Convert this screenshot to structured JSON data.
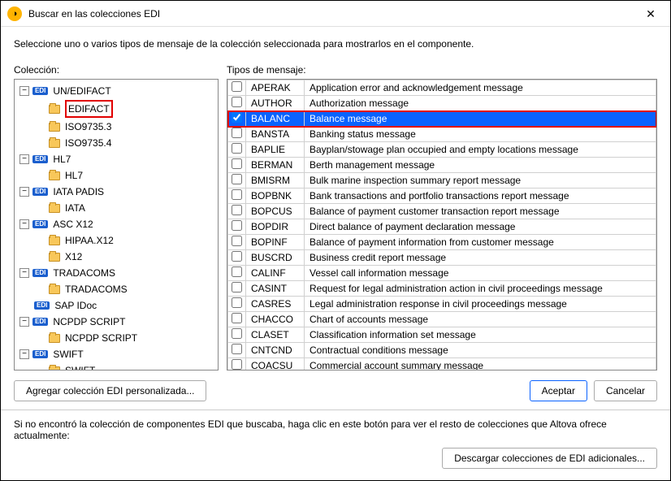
{
  "window": {
    "title": "Buscar en las colecciones EDI"
  },
  "instruction": "Seleccione uno o varios tipos de mensaje de la colección seleccionada para mostrarlos en el componente.",
  "labels": {
    "collection": "Colección:",
    "message_types": "Tipos de mensaje:",
    "add_custom": "Agregar colección EDI personalizada...",
    "accept": "Aceptar",
    "cancel": "Cancelar",
    "footer_text": "Si no encontró la colección de componentes EDI que buscaba, haga clic en este botón para ver el resto de colecciones que Altova ofrece actualmente:",
    "download_more": "Descargar colecciones de EDI adicionales..."
  },
  "tree": [
    {
      "label": "UN/EDIFACT",
      "icon": "edi",
      "expanded": true,
      "children": [
        {
          "label": "EDIFACT",
          "icon": "folder",
          "highlight": true
        },
        {
          "label": "ISO9735.3",
          "icon": "folder"
        },
        {
          "label": "ISO9735.4",
          "icon": "folder"
        }
      ]
    },
    {
      "label": "HL7",
      "icon": "edi",
      "expanded": true,
      "children": [
        {
          "label": "HL7",
          "icon": "folder"
        }
      ]
    },
    {
      "label": "IATA PADIS",
      "icon": "edi",
      "expanded": true,
      "children": [
        {
          "label": "IATA",
          "icon": "folder"
        }
      ]
    },
    {
      "label": "ASC X12",
      "icon": "edi",
      "expanded": true,
      "children": [
        {
          "label": "HIPAA.X12",
          "icon": "folder"
        },
        {
          "label": "X12",
          "icon": "folder"
        }
      ]
    },
    {
      "label": "TRADACOMS",
      "icon": "edi",
      "expanded": true,
      "children": [
        {
          "label": "TRADACOMS",
          "icon": "folder"
        }
      ]
    },
    {
      "label": "SAP IDoc",
      "icon": "edi",
      "leaf": true
    },
    {
      "label": "NCPDP SCRIPT",
      "icon": "edi",
      "expanded": true,
      "children": [
        {
          "label": "NCPDP SCRIPT",
          "icon": "folder"
        }
      ]
    },
    {
      "label": "SWIFT",
      "icon": "edi",
      "expanded": true,
      "children": [
        {
          "label": "SWIFT",
          "icon": "folder"
        }
      ]
    }
  ],
  "messages": [
    {
      "code": "APERAK",
      "desc": "Application error and acknowledgement message",
      "checked": false
    },
    {
      "code": "AUTHOR",
      "desc": "Authorization message",
      "checked": false
    },
    {
      "code": "BALANC",
      "desc": "Balance message",
      "checked": true,
      "selected": true
    },
    {
      "code": "BANSTA",
      "desc": "Banking status message",
      "checked": false
    },
    {
      "code": "BAPLIE",
      "desc": "Bayplan/stowage plan occupied and empty locations message",
      "checked": false
    },
    {
      "code": "BERMAN",
      "desc": "Berth management message",
      "checked": false
    },
    {
      "code": "BMISRM",
      "desc": "Bulk marine inspection summary report message",
      "checked": false
    },
    {
      "code": "BOPBNK",
      "desc": "Bank transactions and portfolio transactions report message",
      "checked": false
    },
    {
      "code": "BOPCUS",
      "desc": "Balance of payment customer transaction report message",
      "checked": false
    },
    {
      "code": "BOPDIR",
      "desc": "Direct balance of payment declaration message",
      "checked": false
    },
    {
      "code": "BOPINF",
      "desc": "Balance of payment information from customer message",
      "checked": false
    },
    {
      "code": "BUSCRD",
      "desc": "Business credit report message",
      "checked": false
    },
    {
      "code": "CALINF",
      "desc": "Vessel call information message",
      "checked": false
    },
    {
      "code": "CASINT",
      "desc": "Request for legal administration action in civil proceedings message",
      "checked": false
    },
    {
      "code": "CASRES",
      "desc": "Legal administration response in civil proceedings message",
      "checked": false
    },
    {
      "code": "CHACCO",
      "desc": "Chart of accounts message",
      "checked": false
    },
    {
      "code": "CLASET",
      "desc": "Classification information set message",
      "checked": false
    },
    {
      "code": "CNTCND",
      "desc": "Contractual conditions message",
      "checked": false
    },
    {
      "code": "COACSU",
      "desc": "Commercial account summary message",
      "checked": false
    }
  ]
}
